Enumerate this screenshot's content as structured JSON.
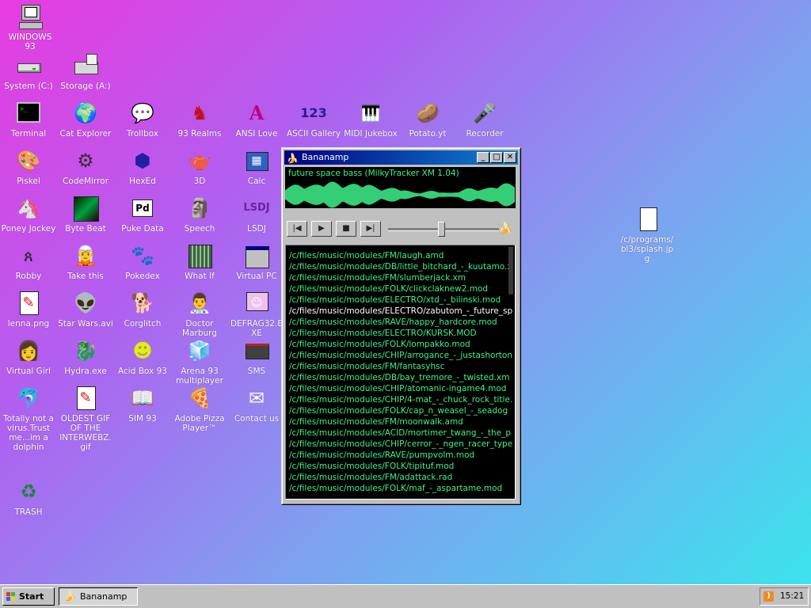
{
  "desktop": {
    "icons": [
      {
        "label": "WINDOWS 93"
      },
      {
        "label": "System (C:)"
      },
      {
        "label": "Storage (A:)"
      },
      {
        "label": "Terminal"
      },
      {
        "label": "Cat Explorer"
      },
      {
        "label": "Trollbox"
      },
      {
        "label": "93 Realms"
      },
      {
        "label": "ANSI Love"
      },
      {
        "label": "ASCII Gallery"
      },
      {
        "label": "MIDI Jukebox"
      },
      {
        "label": "Potato.yt"
      },
      {
        "label": "Recorder"
      },
      {
        "label": "Piskel"
      },
      {
        "label": "CodeMirror"
      },
      {
        "label": "HexEd"
      },
      {
        "label": "3D"
      },
      {
        "label": "Calc"
      },
      {
        "label": "Poney Jockey"
      },
      {
        "label": "Byte Beat"
      },
      {
        "label": "Puke Data"
      },
      {
        "label": "Speech"
      },
      {
        "label": "LSDJ"
      },
      {
        "label": "Robby"
      },
      {
        "label": "Take this"
      },
      {
        "label": "Pokedex"
      },
      {
        "label": "What If"
      },
      {
        "label": "Virtual PC"
      },
      {
        "label": "lenna.png"
      },
      {
        "label": "Star Wars.avi"
      },
      {
        "label": "Corglitch"
      },
      {
        "label": "Doctor Marburg"
      },
      {
        "label": "DEFRAG32.EXE"
      },
      {
        "label": "Virtual Girl"
      },
      {
        "label": "Hydra.exe"
      },
      {
        "label": "Acid Box 93"
      },
      {
        "label": "Arena 93 multiplayer"
      },
      {
        "label": "SMS"
      },
      {
        "label": "Totally not a virus.Trust me...im a dolphin"
      },
      {
        "label": "OLDEST GIF OF THE INTERWEBZ.gif"
      },
      {
        "label": "SIM 93"
      },
      {
        "label": "Adobe Pizza Player™"
      },
      {
        "label": "Contact us"
      },
      {
        "label": "TRASH"
      },
      {
        "label": "/c/programs/bl3/splash.jpg"
      }
    ]
  },
  "player": {
    "title": "Bananamp",
    "now_playing": "future space bass (MilkyTracker XM 1.04)",
    "time": "--:--",
    "seek_fraction": 0.48,
    "playlist": [
      "/c/files/music/modules/FM/laugh.amd",
      "/c/files/music/modules/DB/little_bitchard_-_kuutamo.xm",
      "/c/files/music/modules/FM/slumberjack.xm",
      "/c/files/music/modules/FOLK/clickclaknew2.mod",
      "/c/files/music/modules/ELECTRO/xtd_-_bilinski.mod",
      "/c/files/music/modules/ELECTRO/zabutom_-_future_space",
      "/c/files/music/modules/RAVE/happy_hardcore.mod",
      "/c/files/music/modules/ELECTRO/KURSK.MOD",
      "/c/files/music/modules/FOLK/lompakko.mod",
      "/c/files/music/modules/CHIP/arrogance_-_justashortone",
      "/c/files/music/modules/FM/fantasyhsc",
      "/c/files/music/modules/DB/bay_tremore_-_twisted.xm",
      "/c/files/music/modules/CHIP/atomanic-ingame4.mod",
      "/c/files/music/modules/CHIP/4-mat_-_chuck_rock_title.",
      "/c/files/music/modules/FOLK/cap_n_weasel_-_seadog",
      "/c/files/music/modules/FM/moonwalk.amd",
      "/c/files/music/modules/ACID/mortimer_twang_-_the_p",
      "/c/files/music/modules/CHIP/cerror_-_ngen_racer_type",
      "/c/files/music/modules/RAVE/pumpvolm.mod",
      "/c/files/music/modules/FOLK/tipituf.mod",
      "/c/files/music/modules/FM/adattack.rad",
      "/c/files/music/modules/FOLK/maf_-_aspartame.mod"
    ],
    "selected_index": 5
  },
  "taskbar": {
    "start_label": "Start",
    "task_label": "Bananamp",
    "clock": "15:21"
  },
  "colors": {
    "accent_green": "#3cf28a",
    "title_start": "#000080",
    "title_end": "#1084d0"
  }
}
